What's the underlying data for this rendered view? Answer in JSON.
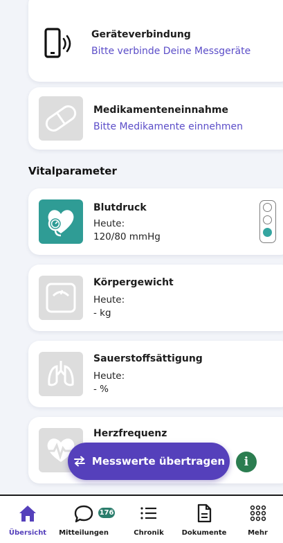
{
  "cards_top": {
    "device": {
      "title": "Geräteverbindung",
      "subtitle": "Bitte verbinde Deine Messgeräte",
      "icon": "phone-signal-icon"
    },
    "medication": {
      "title": "Medikamenteneinnahme",
      "subtitle": "Bitte Medikamente einnehmen",
      "icon": "pill-icon"
    }
  },
  "vitals": {
    "section_title": "Vitalparameter",
    "items": [
      {
        "title": "Blutdruck",
        "label": "Heute:",
        "value": "120/80 mmHg",
        "icon": "blood-pressure-icon",
        "status": "green-traffic-light"
      },
      {
        "title": "Körpergewicht",
        "label": "Heute:",
        "value": "- kg",
        "icon": "scale-icon"
      },
      {
        "title": "Sauerstoffsättigung",
        "label": "Heute:",
        "value": "- %",
        "icon": "lungs-icon"
      },
      {
        "title": "Herzfrequenz",
        "icon": "heart-rate-icon"
      }
    ]
  },
  "fab": {
    "label": "Messwerte übertragen",
    "icon": "transfer-arrows-icon"
  },
  "info": {
    "glyph": "i",
    "icon": "info-icon"
  },
  "tabbar": {
    "items": [
      {
        "label": "Übersicht",
        "icon": "home-icon",
        "active": true
      },
      {
        "label": "Mitteilungen",
        "icon": "chat-bubble-icon",
        "badge": "176"
      },
      {
        "label": "Chronik",
        "icon": "list-icon"
      },
      {
        "label": "Dokumente",
        "icon": "document-icon"
      },
      {
        "label": "Mehr",
        "icon": "grid-dots-icon"
      }
    ]
  },
  "colors": {
    "accent": "#5540bb",
    "link": "#5b4dc8",
    "teal": "#2f9c95",
    "badge": "#2b7d6c",
    "info": "#2b7d50",
    "background": "#f2f4f9"
  }
}
